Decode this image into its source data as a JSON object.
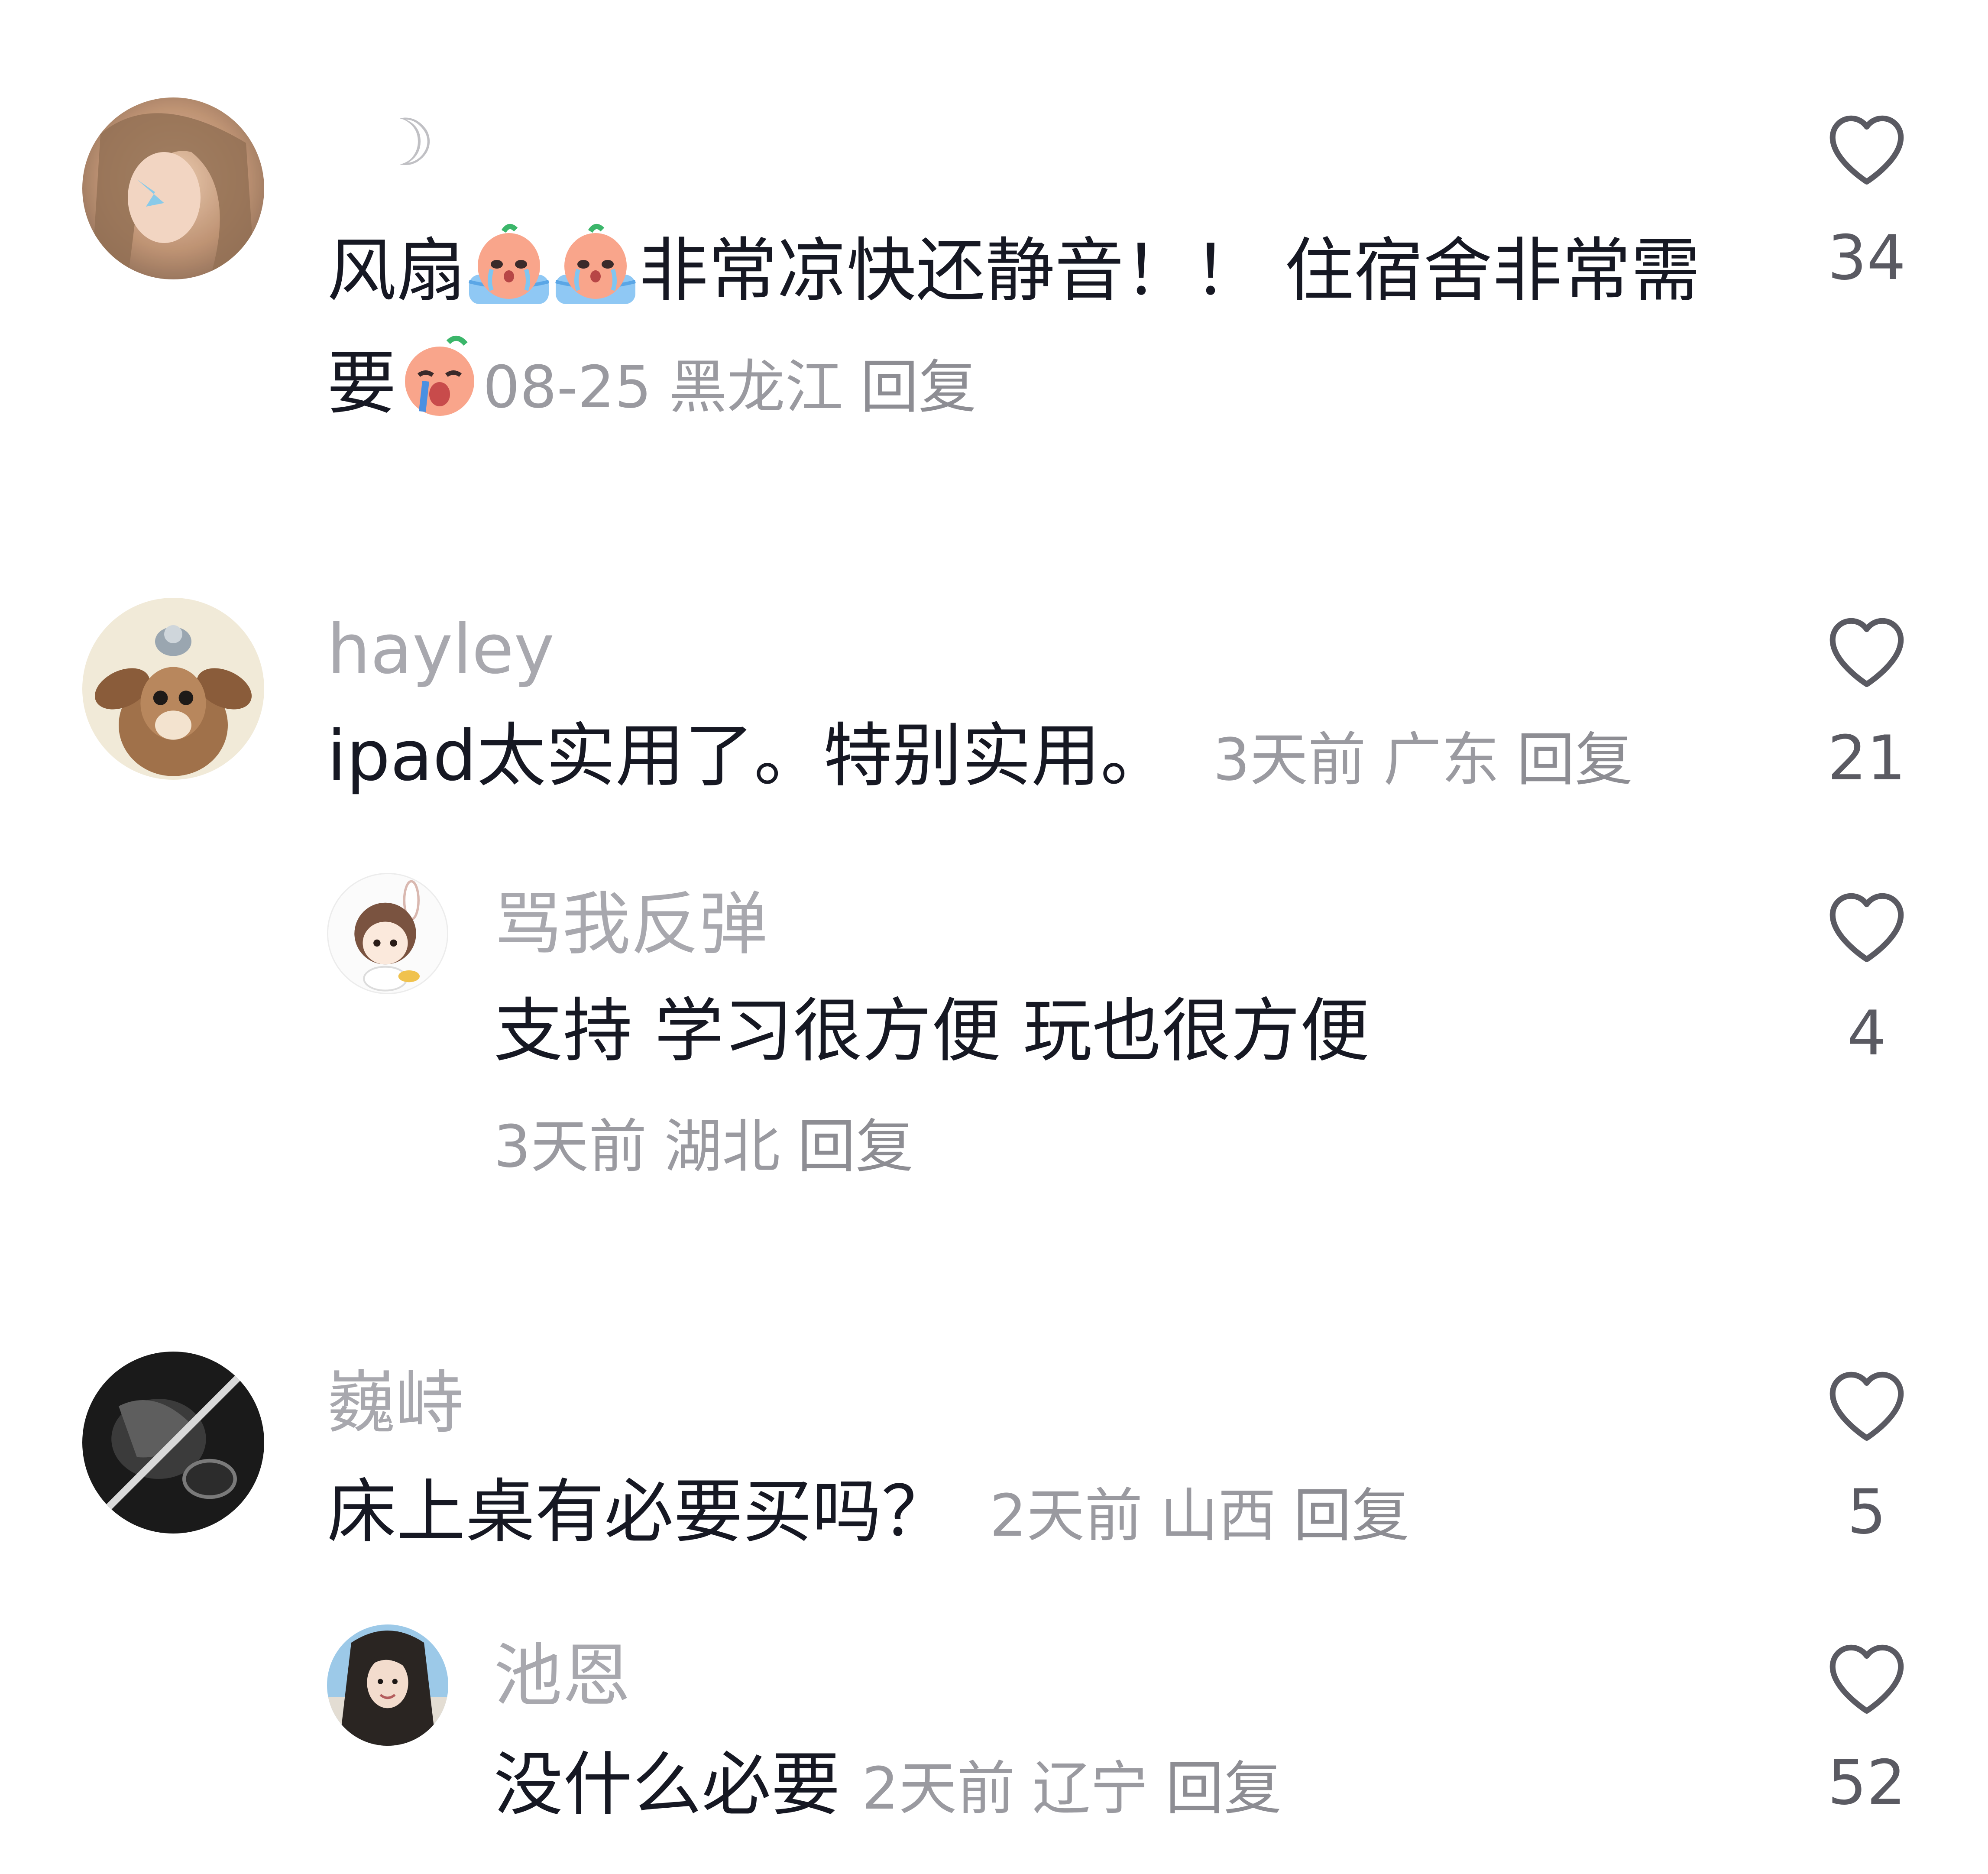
{
  "comments": [
    {
      "username": "☽",
      "text_part1": "风扇",
      "text_part2": "非常凉快还静音！！ 住宿舍非常需",
      "text_part3": "要",
      "time": "08-25",
      "location": "黑龙江",
      "reply_label": "回复",
      "likes": "34"
    },
    {
      "username": "hayley",
      "text": "ipad太实用了。特别实用。",
      "time": "3天前",
      "location": "广东",
      "reply_label": "回复",
      "likes": "21",
      "replies": [
        {
          "username": "骂我反弹",
          "text": "支持 学习很方便 玩也很方便",
          "time": "3天前",
          "location": "湖北",
          "reply_label": "回复",
          "likes": "4"
        }
      ]
    },
    {
      "username": "巍峙",
      "text": "床上桌有必要买吗？",
      "time": "2天前",
      "location": "山西",
      "reply_label": "回复",
      "likes": "5",
      "replies": [
        {
          "username": "池恩",
          "text": "没什么必要",
          "time": "2天前",
          "location": "辽宁",
          "reply_label": "回复",
          "likes": "52"
        }
      ]
    }
  ],
  "icons": {
    "like": "heart-outline-icon",
    "emoji_cry_bath": "crying-peach-emoji",
    "emoji_cry": "crying-peach-emoji"
  },
  "colors": {
    "text": "#161823",
    "username": "#a8a8ae",
    "meta": "#9a9aa0",
    "like_icon": "#5a5a62"
  }
}
